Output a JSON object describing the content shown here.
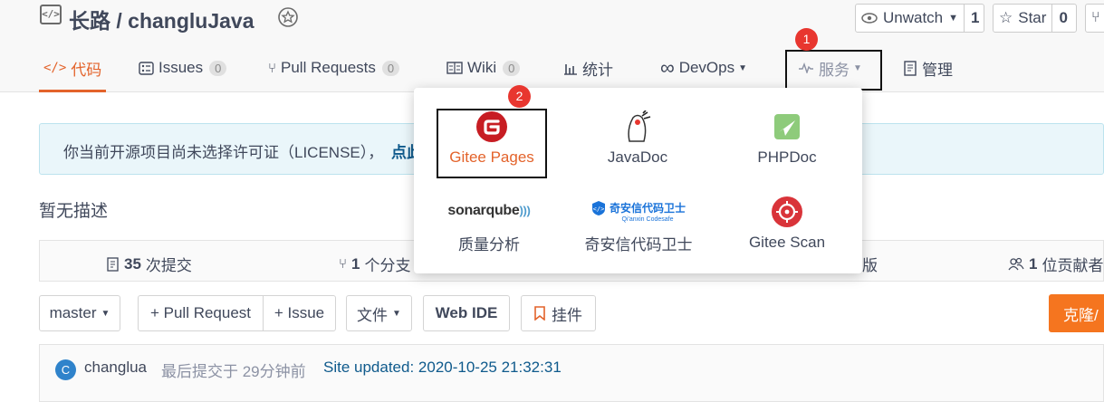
{
  "repo": {
    "title": "长路 / changluJava"
  },
  "header_buttons": {
    "watch_label": "Unwatch",
    "watch_count": "1",
    "star_label": "Star",
    "star_count": "0"
  },
  "tabs": [
    {
      "label": "代码",
      "count": "",
      "icon": "code-icon",
      "active": true
    },
    {
      "label": "Issues",
      "count": "0",
      "icon": "issues-icon"
    },
    {
      "label": "Pull Requests",
      "count": "0",
      "icon": "pull-request-icon"
    },
    {
      "label": "Wiki",
      "count": "0",
      "icon": "wiki-icon"
    },
    {
      "label": "统计",
      "count": "",
      "icon": "stats-icon"
    },
    {
      "label": "DevOps",
      "count": "",
      "icon": "infinity-icon"
    },
    {
      "label": "服务",
      "count": "",
      "icon": "pulse-icon"
    },
    {
      "label": "管理",
      "count": "",
      "icon": "manage-icon"
    }
  ],
  "markers": {
    "m1": "1",
    "m2": "2"
  },
  "banner": {
    "text": "你当前开源项目尚未选择许可证（LICENSE），",
    "link": "点此"
  },
  "description": "暂无描述",
  "stats": {
    "commits_count": "35",
    "commits_label": "次提交",
    "branches_count": "1",
    "branches_label": "个分支",
    "releases_label": "版",
    "contributors_count": "1",
    "contributors_label": "位贡献者"
  },
  "toolbar": {
    "branch": "master",
    "pull_request": "+ Pull Request",
    "issue": "+ Issue",
    "file": "文件",
    "web_ide": "Web IDE",
    "widget": "挂件",
    "clone": "克隆/"
  },
  "commit": {
    "avatar_letter": "C",
    "author": "changlua",
    "time": "最后提交于 29分钟前",
    "message": "Site updated: 2020-10-25 21:32:31"
  },
  "services": [
    {
      "label": "Gitee Pages",
      "icon": "gitee-pages-icon"
    },
    {
      "label": "JavaDoc",
      "icon": "javadoc-icon"
    },
    {
      "label": "PHPDoc",
      "icon": "phpdoc-icon"
    },
    {
      "label": "质量分析",
      "icon": "sonarqube-icon",
      "logo_text": "sonarqube"
    },
    {
      "label": "奇安信代码卫士",
      "icon": "qianxin-icon",
      "logo_text": "奇安信代码卫士",
      "logo_sub": "Qi'anxin Codesafe"
    },
    {
      "label": "Gitee Scan",
      "icon": "gitee-scan-icon"
    }
  ],
  "colors": {
    "accent": "#e3632b",
    "marker": "#e8362f",
    "clone": "#f5751f",
    "link": "#0f5a8c"
  }
}
